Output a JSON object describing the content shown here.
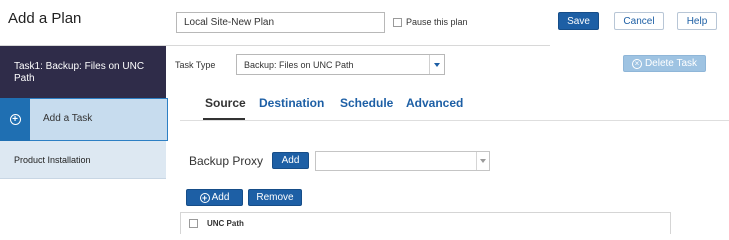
{
  "header": {
    "title": "Add a Plan",
    "plan_name_value": "Local Site-New Plan",
    "pause_label": "Pause this plan",
    "save_label": "Save",
    "cancel_label": "Cancel",
    "help_label": "Help"
  },
  "sidebar": {
    "items": [
      {
        "label": "Task1: Backup: Files on UNC Path",
        "state": "selected"
      },
      {
        "label": "Add a Task",
        "icon": "plus-circle-icon",
        "state": "active"
      },
      {
        "label": "Product Installation"
      }
    ]
  },
  "task": {
    "type_label": "Task Type",
    "type_value": "Backup: Files on UNC Path",
    "delete_label": "Delete Task"
  },
  "tabs": [
    {
      "label": "Source",
      "active": true
    },
    {
      "label": "Destination"
    },
    {
      "label": "Schedule"
    },
    {
      "label": "Advanced"
    }
  ],
  "source": {
    "proxy_label": "Backup Proxy",
    "proxy_add_label": "Add",
    "proxy_value": "",
    "add_label": "Add",
    "remove_label": "Remove",
    "table": {
      "columns": [
        "UNC Path"
      ]
    }
  },
  "colors": {
    "primary": "#1d5fa5",
    "sidebar_dark": "#2f2c49",
    "sidebar_active": "#c7dcee",
    "sidebar_icon_bg": "#1f6fb2"
  }
}
